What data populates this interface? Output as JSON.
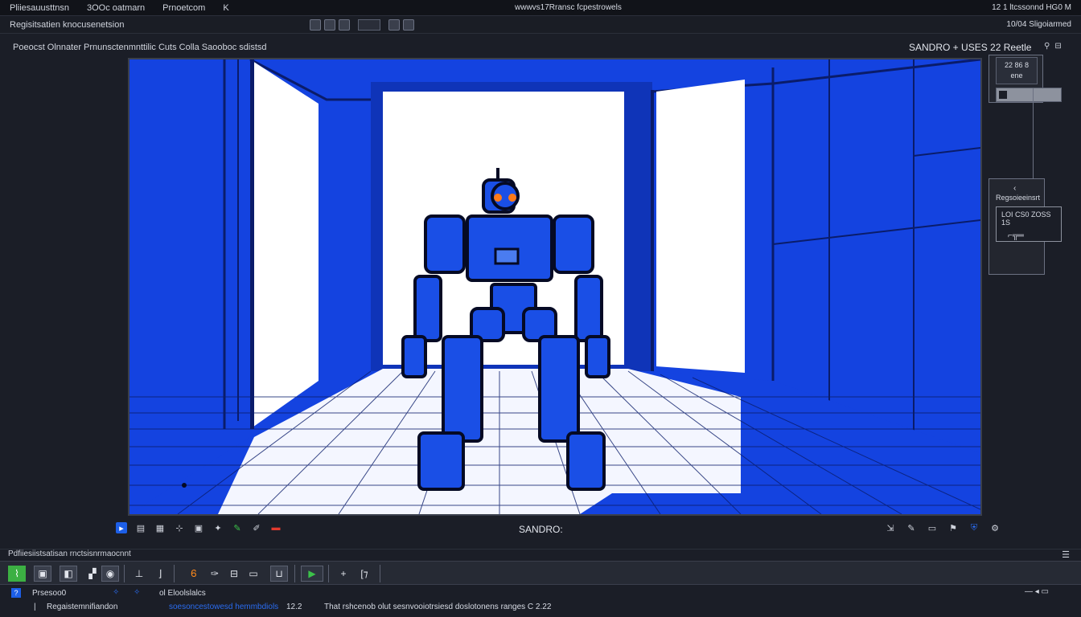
{
  "menubar": {
    "items": [
      "Pliiesauusttnsn",
      "3OOc oatmarn",
      "Prnoetcom",
      "K"
    ],
    "center": "wwwvs17Rransc fcpestrowels",
    "right": "12 1 ltcssonnd HG0 M"
  },
  "subbar": {
    "left": "Regisitsatien knocusenetsion",
    "right": "10/04 Sligoiarmed"
  },
  "doc_title": "Poeocst Olnnater Prnunsctenmnttilic Cuts Colla Saooboc sdistsd",
  "viewport": {
    "label": "SANDRO +",
    "label_suffix": "USES 22 Reetle",
    "scene_description_icon": "robot-scene"
  },
  "side_panel_a": {
    "line1": "22 86 8",
    "line2": "ene"
  },
  "side_panel_b": {
    "chevron": "‹",
    "title": "Regsoieeinsrt",
    "box_text": "LOI CS0 ZOSS 1S",
    "icon": "gun-icon"
  },
  "viewport_toolbar": {
    "center_label": "SANDRO:"
  },
  "timeline": {
    "header": "Pdfiiesiistsatisan rnctsisnrmaocnnt"
  },
  "status1": {
    "left": "Prsesoo0",
    "mid": "ol Eloolslalcs",
    "right": "— ◂ ▭"
  },
  "status2": {
    "bar": "|",
    "t1": "Regaistemnifiandon",
    "t2": "soesoncestowesd hemmbdiols",
    "t3": "12.2",
    "t4": "That rshcenob olut sesnvooiotrsiesd doslotonens ranges C 2.22"
  }
}
